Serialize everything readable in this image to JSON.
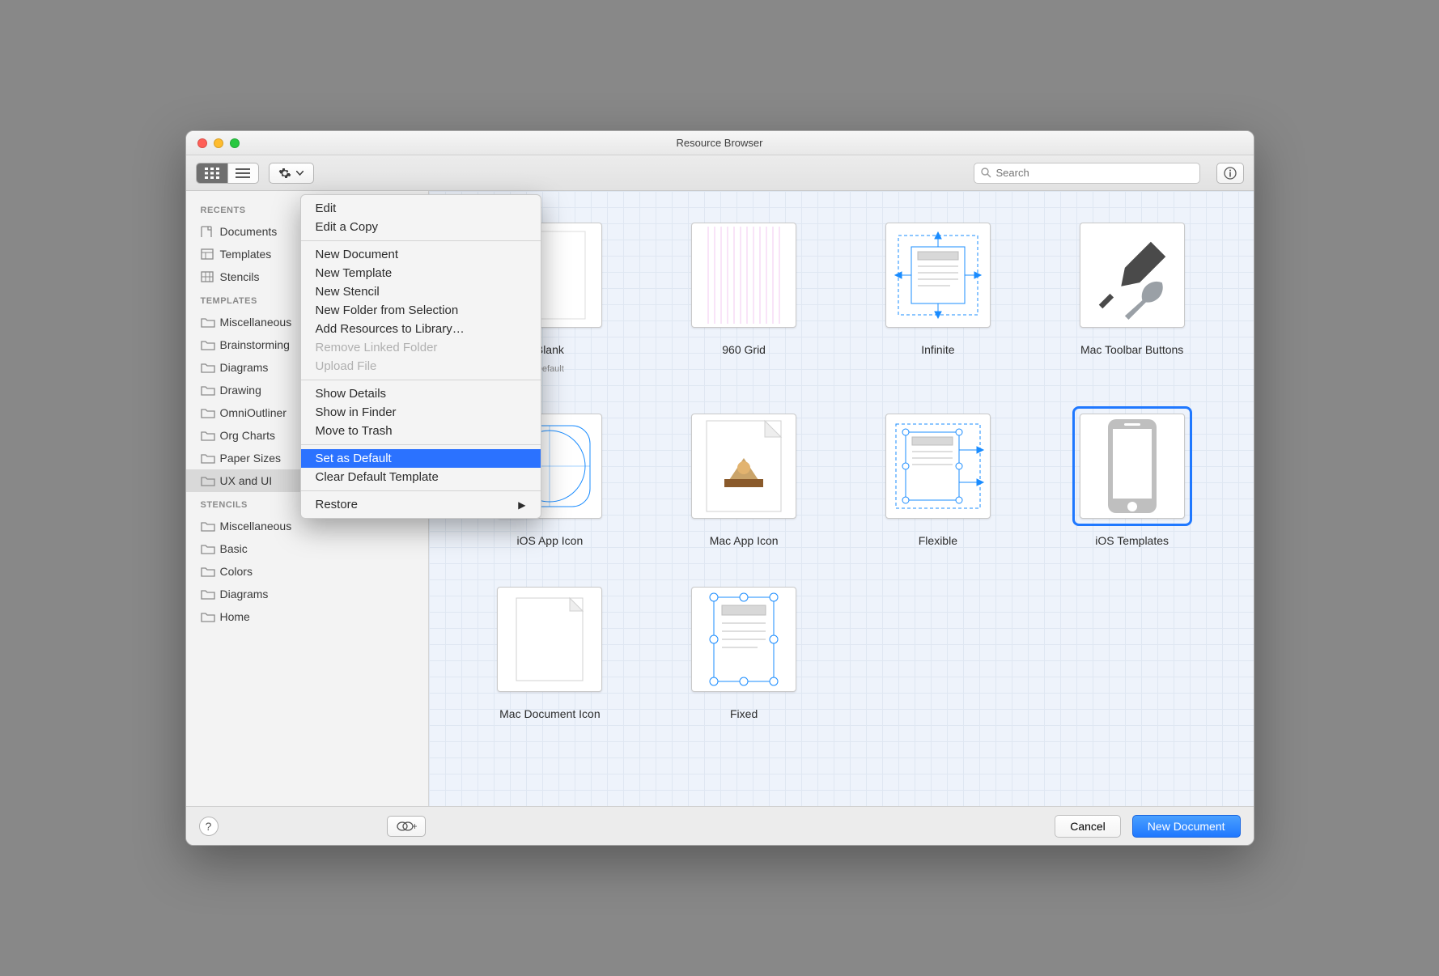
{
  "window": {
    "title": "Resource Browser"
  },
  "toolbar": {
    "search_placeholder": "Search"
  },
  "sidebar": {
    "sections": [
      {
        "header": "RECENTS",
        "items": [
          {
            "icon": "doc",
            "label": "Documents"
          },
          {
            "icon": "tmpl",
            "label": "Templates"
          },
          {
            "icon": "sten",
            "label": "Stencils"
          }
        ]
      },
      {
        "header": "TEMPLATES",
        "items": [
          {
            "icon": "folder",
            "label": "Miscellaneous"
          },
          {
            "icon": "folder",
            "label": "Brainstorming"
          },
          {
            "icon": "folder",
            "label": "Diagrams"
          },
          {
            "icon": "folder",
            "label": "Drawing"
          },
          {
            "icon": "folder",
            "label": "OmniOutliner"
          },
          {
            "icon": "folder",
            "label": "Org Charts"
          },
          {
            "icon": "folder",
            "label": "Paper Sizes"
          },
          {
            "icon": "folder",
            "label": "UX and UI",
            "selected": true
          }
        ]
      },
      {
        "header": "STENCILS",
        "items": [
          {
            "icon": "folder",
            "label": "Miscellaneous"
          },
          {
            "icon": "folder",
            "label": "Basic"
          },
          {
            "icon": "folder",
            "label": "Colors"
          },
          {
            "icon": "folder",
            "label": "Diagrams"
          },
          {
            "icon": "folder",
            "label": "Home"
          }
        ]
      }
    ]
  },
  "items": [
    {
      "label": "Blank",
      "sublabel": "Default",
      "kind": "blank"
    },
    {
      "label": "960 Grid",
      "kind": "grid960"
    },
    {
      "label": "Infinite",
      "kind": "infinite"
    },
    {
      "label": "Mac Toolbar Buttons",
      "kind": "tools"
    },
    {
      "label": "iOS App Icon",
      "kind": "iosicon"
    },
    {
      "label": "Mac App Icon",
      "kind": "macicon"
    },
    {
      "label": "Flexible",
      "kind": "flexible"
    },
    {
      "label": "iOS Templates",
      "kind": "iphone",
      "selected": true
    },
    {
      "label": "Mac Document Icon",
      "kind": "macdoc"
    },
    {
      "label": "Fixed",
      "kind": "fixed"
    }
  ],
  "menu": {
    "groups": [
      [
        {
          "label": "Edit"
        },
        {
          "label": "Edit a Copy"
        }
      ],
      [
        {
          "label": "New Document"
        },
        {
          "label": "New Template"
        },
        {
          "label": "New Stencil"
        },
        {
          "label": "New Folder from Selection"
        },
        {
          "label": "Add Resources to Library…"
        },
        {
          "label": "Remove Linked Folder",
          "disabled": true
        },
        {
          "label": "Upload File",
          "disabled": true
        }
      ],
      [
        {
          "label": "Show Details"
        },
        {
          "label": "Show in Finder"
        },
        {
          "label": "Move to Trash"
        }
      ],
      [
        {
          "label": "Set as Default",
          "highlighted": true
        },
        {
          "label": "Clear Default Template"
        }
      ],
      [
        {
          "label": "Restore",
          "submenu": true
        }
      ]
    ]
  },
  "footer": {
    "cancel": "Cancel",
    "primary": "New Document"
  }
}
